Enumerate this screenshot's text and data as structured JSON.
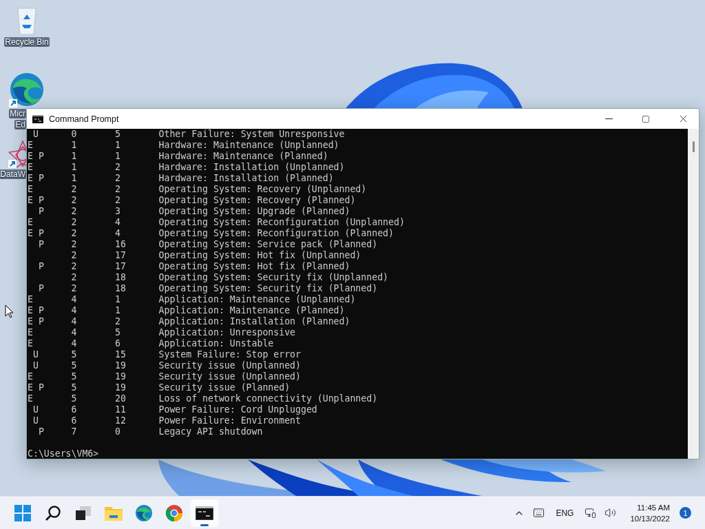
{
  "desktop_icons": [
    {
      "kind": "recycle-bin",
      "label_lines": [
        "Recycle Bin"
      ],
      "cut": false
    },
    {
      "kind": "edge",
      "label_lines": [
        "Micr",
        "Ed"
      ],
      "cut": true
    },
    {
      "kind": "star-app",
      "label_lines": [
        "DataW"
      ],
      "cut": true
    }
  ],
  "window": {
    "title": "Command Prompt",
    "rows": [
      {
        "flags": " U",
        "category": "0",
        "code": "5",
        "description": "Other Failure: System Unresponsive"
      },
      {
        "flags": "E",
        "category": "1",
        "code": "1",
        "description": "Hardware: Maintenance (Unplanned)"
      },
      {
        "flags": "E P",
        "category": "1",
        "code": "1",
        "description": "Hardware: Maintenance (Planned)"
      },
      {
        "flags": "E",
        "category": "1",
        "code": "2",
        "description": "Hardware: Installation (Unplanned)"
      },
      {
        "flags": "E P",
        "category": "1",
        "code": "2",
        "description": "Hardware: Installation (Planned)"
      },
      {
        "flags": "E",
        "category": "2",
        "code": "2",
        "description": "Operating System: Recovery (Unplanned)"
      },
      {
        "flags": "E P",
        "category": "2",
        "code": "2",
        "description": "Operating System: Recovery (Planned)"
      },
      {
        "flags": "  P",
        "category": "2",
        "code": "3",
        "description": "Operating System: Upgrade (Planned)"
      },
      {
        "flags": "E",
        "category": "2",
        "code": "4",
        "description": "Operating System: Reconfiguration (Unplanned)"
      },
      {
        "flags": "E P",
        "category": "2",
        "code": "4",
        "description": "Operating System: Reconfiguration (Planned)"
      },
      {
        "flags": "  P",
        "category": "2",
        "code": "16",
        "description": "Operating System: Service pack (Planned)"
      },
      {
        "category": "2",
        "code": "17",
        "description": "Operating System: Hot fix (Unplanned)"
      },
      {
        "flags": "  P",
        "category": "2",
        "code": "17",
        "description": "Operating System: Hot fix (Planned)"
      },
      {
        "category": "2",
        "code": "18",
        "description": "Operating System: Security fix (Unplanned)"
      },
      {
        "flags": "  P",
        "category": "2",
        "code": "18",
        "description": "Operating System: Security fix (Planned)"
      },
      {
        "flags": "E",
        "category": "4",
        "code": "1",
        "description": "Application: Maintenance (Unplanned)"
      },
      {
        "flags": "E P",
        "category": "4",
        "code": "1",
        "description": "Application: Maintenance (Planned)"
      },
      {
        "flags": "E P",
        "category": "4",
        "code": "2",
        "description": "Application: Installation (Planned)"
      },
      {
        "flags": "E",
        "category": "4",
        "code": "5",
        "description": "Application: Unresponsive"
      },
      {
        "flags": "E",
        "category": "4",
        "code": "6",
        "description": "Application: Unstable"
      },
      {
        "flags": " U",
        "category": "5",
        "code": "15",
        "description": "System Failure: Stop error"
      },
      {
        "flags": " U",
        "category": "5",
        "code": "19",
        "description": "Security issue (Unplanned)"
      },
      {
        "flags": "E",
        "category": "5",
        "code": "19",
        "description": "Security issue (Unplanned)"
      },
      {
        "flags": "E P",
        "category": "5",
        "code": "19",
        "description": "Security issue (Planned)"
      },
      {
        "flags": "E",
        "category": "5",
        "code": "20",
        "description": "Loss of network connectivity (Unplanned)"
      },
      {
        "flags": " U",
        "category": "6",
        "code": "11",
        "description": "Power Failure: Cord Unplugged"
      },
      {
        "flags": " U",
        "category": "6",
        "code": "12",
        "description": "Power Failure: Environment"
      },
      {
        "flags": "  P",
        "category": "7",
        "code": "0",
        "description": "Legacy API shutdown"
      }
    ],
    "prompt": "C:\\Users\\VM6>"
  },
  "taskbar": {
    "apps": [
      {
        "kind": "start",
        "active": false
      },
      {
        "kind": "search",
        "active": false
      },
      {
        "kind": "task-view",
        "active": false
      },
      {
        "kind": "explorer",
        "active": false
      },
      {
        "kind": "edge",
        "active": false
      },
      {
        "kind": "chrome",
        "active": false
      },
      {
        "kind": "terminal",
        "active": true
      }
    ],
    "language": "ENG",
    "time": "11:45 AM",
    "date": "10/13/2022",
    "notifications": "1"
  }
}
